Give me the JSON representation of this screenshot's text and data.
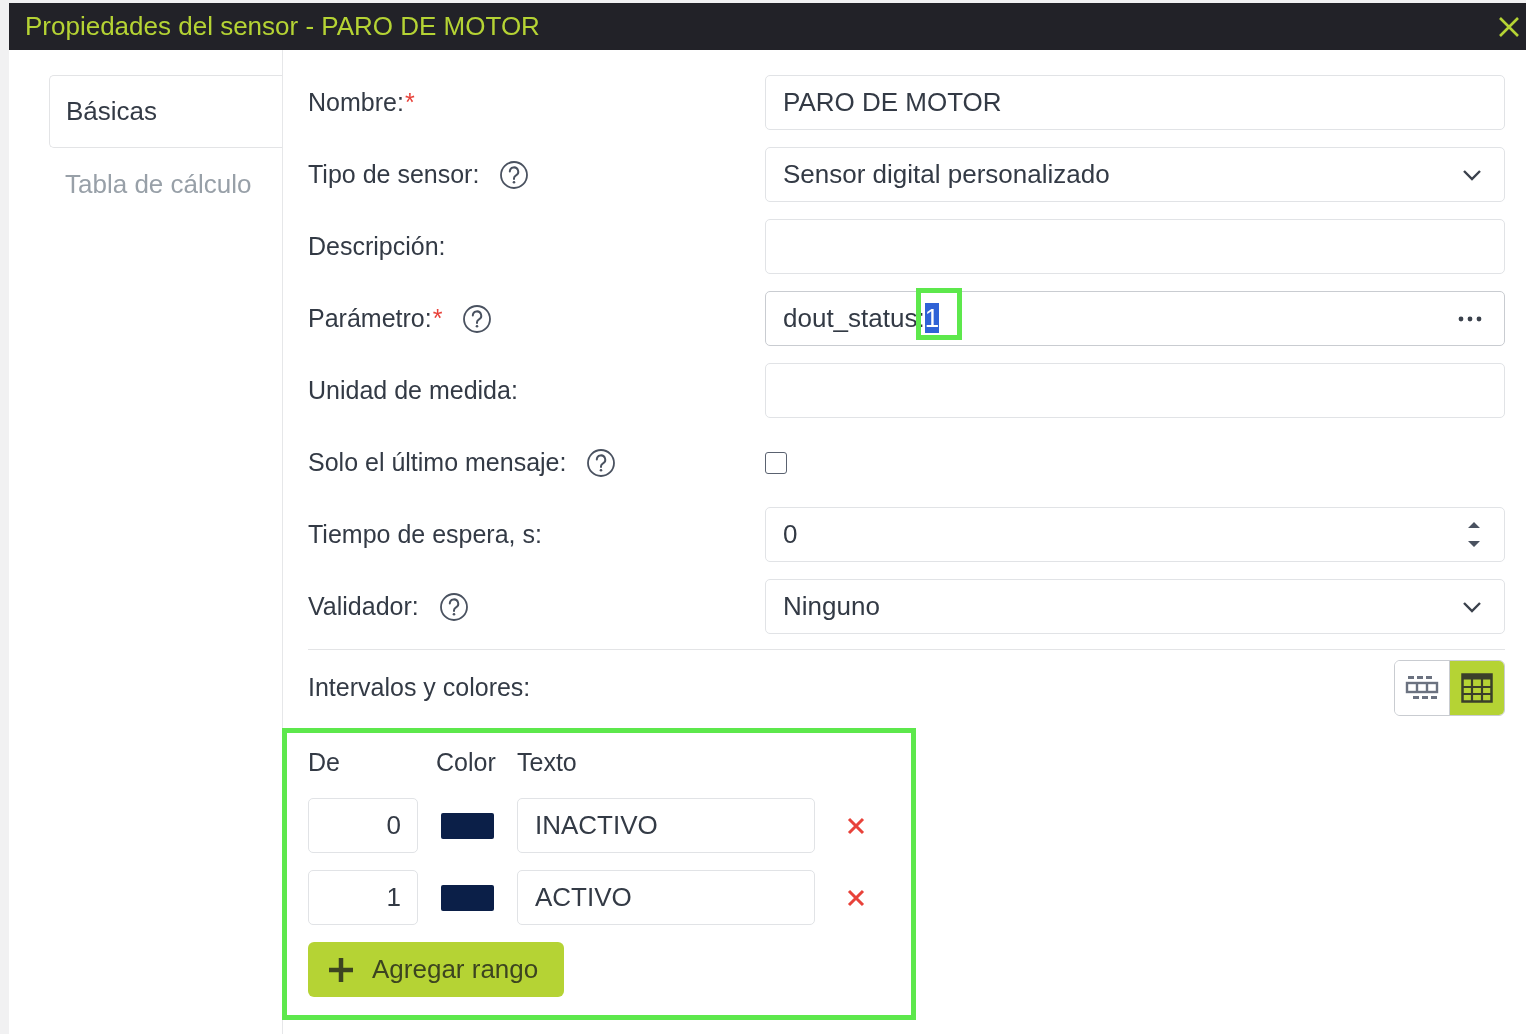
{
  "window": {
    "title": "Propiedades del sensor - PARO DE MOTOR"
  },
  "tabs": [
    {
      "label": "Básicas",
      "selected": true
    },
    {
      "label": "Tabla de cálculo",
      "selected": false
    }
  ],
  "fields": [
    {
      "kind": "text",
      "label": "Nombre:",
      "required_mark": "*",
      "help": false,
      "value": "PARO DE MOTOR"
    },
    {
      "kind": "select",
      "label": "Tipo de sensor:",
      "help": true,
      "value": "Sensor digital personalizado"
    },
    {
      "kind": "text",
      "label": "Descripción:",
      "help": false
    },
    {
      "kind": "picker",
      "label": "Parámetro:",
      "required_mark": "*",
      "help": true,
      "value": "dout_status:",
      "selected_text": "1",
      "highlighted": true
    },
    {
      "kind": "text",
      "label": "Unidad de medida:",
      "help": false
    },
    {
      "kind": "checkbox",
      "label": "Solo el último mensaje:",
      "help": true,
      "checked": false
    },
    {
      "kind": "number",
      "label": "Tiempo de espera, s:",
      "help": false,
      "value": "0"
    },
    {
      "kind": "select",
      "label": "Validador:",
      "help": true,
      "value": "Ninguno"
    }
  ],
  "intervals": {
    "label": "Intervalos y colores:",
    "view_modes": [
      {
        "kind": "list",
        "selected": false
      },
      {
        "kind": "table",
        "selected": true
      }
    ],
    "highlighted": true,
    "columns": [
      "De",
      "Color",
      "Texto"
    ],
    "rows": [
      {
        "from": "0",
        "color": "#0b1f48",
        "text": "INACTIVO"
      },
      {
        "from": "1",
        "color": "#0b1f48",
        "text": "ACTIVO"
      }
    ],
    "add_button": "Agregar rango"
  }
}
